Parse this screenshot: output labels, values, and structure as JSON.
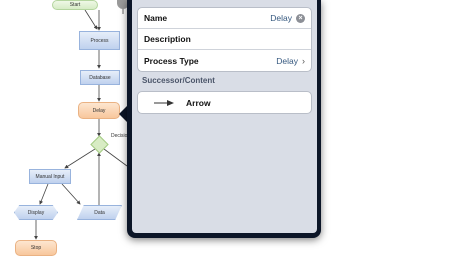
{
  "flowchart": {
    "nodes": {
      "start": "Start",
      "process": "Process",
      "database": "Database",
      "delay": "Delay",
      "decision": "Decisio",
      "manual_input": "Manual Input",
      "display": "Display",
      "data": "Data",
      "stop": "Stop"
    }
  },
  "popover": {
    "rows": {
      "name_label": "Name",
      "name_value": "Delay",
      "description_label": "Description",
      "process_type_label": "Process Type",
      "process_type_value": "Delay"
    },
    "section_header": "Successor/Content",
    "successor": {
      "label": "Arrow"
    }
  }
}
